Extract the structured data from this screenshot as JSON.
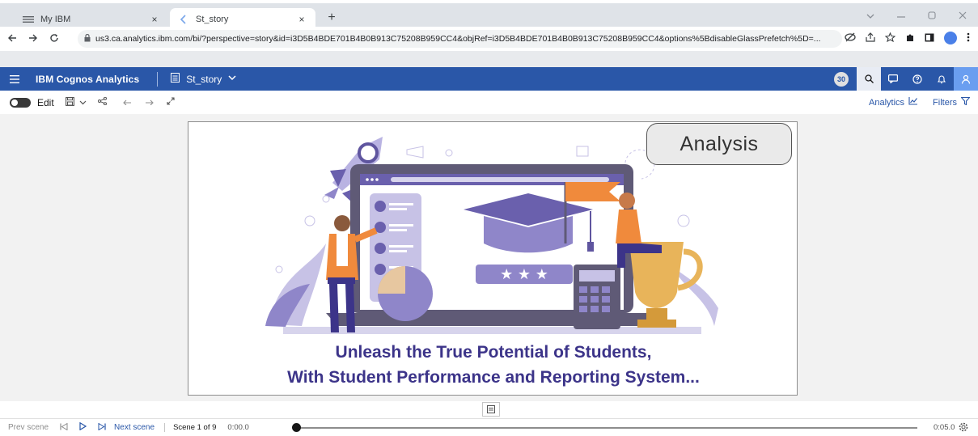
{
  "browser": {
    "tabs": [
      {
        "title": "My IBM",
        "active": false
      },
      {
        "title": "St_story",
        "active": true
      }
    ],
    "close_glyph": "×",
    "new_tab_glyph": "+",
    "url": "us3.ca.analytics.ibm.com/bi/?perspective=story&id=i3D5B4BDE701B4B0B913C75208B959CC4&objRef=i3D5B4BDE701B4B0B913C75208B959CC4&options%5BdisableGlassPrefetch%5D=..."
  },
  "app": {
    "brand": "IBM Cognos Analytics",
    "story_name": "St_story",
    "notification_count": "30",
    "accent_color": "#2a57a8"
  },
  "toolbar": {
    "edit_label": "Edit",
    "analytics_label": "Analytics",
    "filters_label": "Filters"
  },
  "scene": {
    "badge_text": "Analysis",
    "headline_line1": "Unleash the True Potential of Students,",
    "headline_line2": "With Student Performance and Reporting System...",
    "headline_color": "#3c3489"
  },
  "playback": {
    "prev_label": "Prev scene",
    "next_label": "Next scene",
    "scene_counter": "Scene 1 of 9",
    "time_start": "0:00.0",
    "time_end": "0:05.0",
    "progress": 0
  }
}
